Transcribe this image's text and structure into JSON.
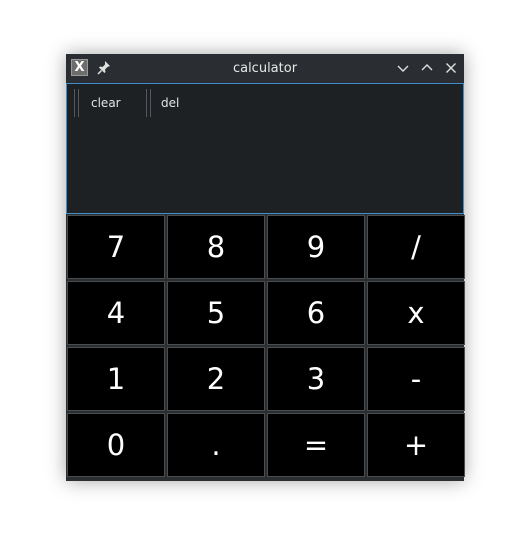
{
  "window": {
    "title": "calculator",
    "icons": [
      "x-app-icon",
      "pin-icon",
      "minimize-icon",
      "maximize-icon",
      "close-icon"
    ]
  },
  "app_icon_glyph": "X",
  "toolbar": {
    "clear_label": "clear",
    "del_label": "del"
  },
  "keys": [
    "7",
    "8",
    "9",
    "/",
    "4",
    "5",
    "6",
    "x",
    "1",
    "2",
    "3",
    "-",
    "0",
    ".",
    "=",
    "+"
  ],
  "colors": {
    "window_bg": "#202326",
    "titlebar_bg": "#2a2e32",
    "accent_border": "#3d8ec9",
    "key_bg": "#000000",
    "key_text": "#ffffff"
  }
}
